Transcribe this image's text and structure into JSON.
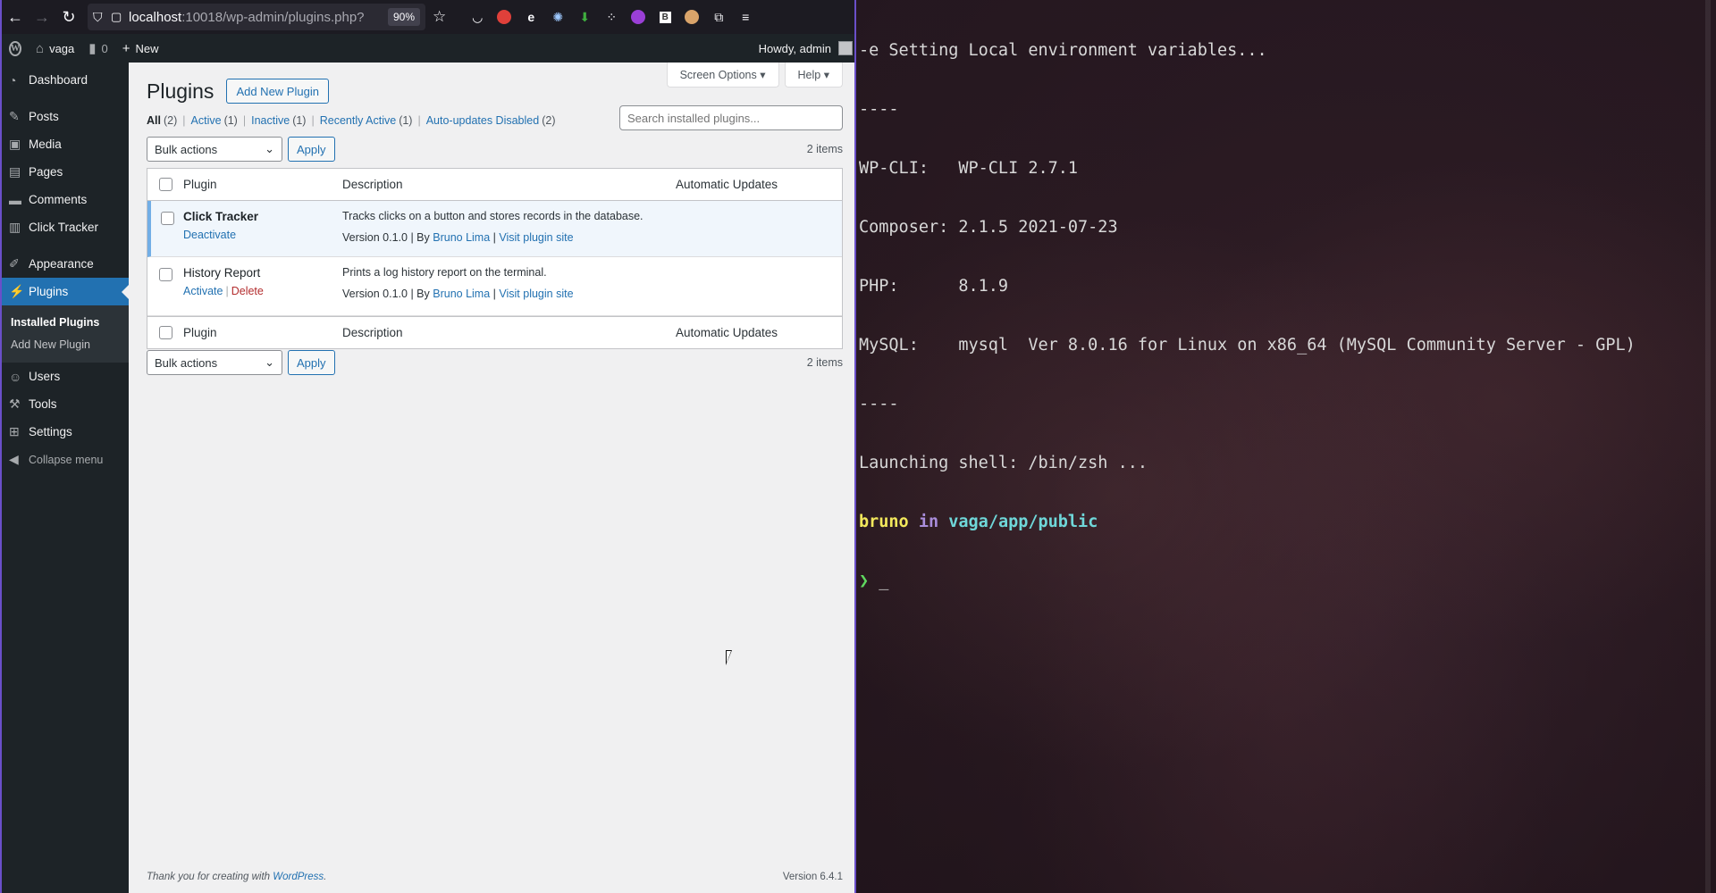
{
  "browser": {
    "url_host": "localhost",
    "url_path": ":10018/wp-admin/plugins.php?",
    "zoom": "90%"
  },
  "adminbar": {
    "site_name": "vaga",
    "comments_count": "0",
    "new_label": "New",
    "howdy": "Howdy, admin"
  },
  "sidebar": {
    "items": [
      {
        "label": "Dashboard",
        "icon": "dashboard-icon"
      },
      {
        "label": "Posts",
        "icon": "pin-icon"
      },
      {
        "label": "Media",
        "icon": "media-icon"
      },
      {
        "label": "Pages",
        "icon": "pages-icon"
      },
      {
        "label": "Comments",
        "icon": "comment-icon"
      },
      {
        "label": "Click Tracker",
        "icon": "chart-icon"
      },
      {
        "label": "Appearance",
        "icon": "brush-icon"
      },
      {
        "label": "Plugins",
        "icon": "plugin-icon"
      },
      {
        "label": "Users",
        "icon": "user-icon"
      },
      {
        "label": "Tools",
        "icon": "wrench-icon"
      },
      {
        "label": "Settings",
        "icon": "settings-icon"
      }
    ],
    "submenu": {
      "installed": "Installed Plugins",
      "add_new": "Add New Plugin"
    },
    "collapse": "Collapse menu"
  },
  "content": {
    "screen_options": "Screen Options",
    "help": "Help",
    "title": "Plugins",
    "add_new_button": "Add New Plugin",
    "filters": {
      "all": "All",
      "all_count": "(2)",
      "active": "Active",
      "active_count": "(1)",
      "inactive": "Inactive",
      "inactive_count": "(1)",
      "recent": "Recently Active",
      "recent_count": "(1)",
      "autoupd": "Auto-updates Disabled",
      "autoupd_count": "(2)"
    },
    "search_placeholder": "Search installed plugins...",
    "bulk_actions": "Bulk actions",
    "apply": "Apply",
    "items_count": "2 items",
    "columns": {
      "plugin": "Plugin",
      "description": "Description",
      "auto_updates": "Automatic Updates"
    },
    "plugins": [
      {
        "name": "Click Tracker",
        "action1": "Deactivate",
        "description": "Tracks clicks on a button and stores records in the database.",
        "version": "Version 0.1.0",
        "by": "By",
        "author": "Bruno Lima",
        "visit": "Visit plugin site"
      },
      {
        "name": "History Report",
        "action1": "Activate",
        "action2": "Delete",
        "description": "Prints a log history report on the terminal.",
        "version": "Version 0.1.0",
        "by": "By",
        "author": "Bruno Lima",
        "visit": "Visit plugin site"
      }
    ],
    "footer_thanks": "Thank you for creating with",
    "footer_link": "WordPress",
    "footer_version": "Version 6.4.1"
  },
  "terminal": {
    "lines": [
      "-e Setting Local environment variables...",
      "----",
      "WP-CLI:   WP-CLI 2.7.1",
      "Composer: 2.1.5 2021-07-23",
      "PHP:      8.1.9",
      "MySQL:    mysql  Ver 8.0.16 for Linux on x86_64 (MySQL Community Server - GPL)",
      "----",
      "Launching shell: /bin/zsh ..."
    ],
    "prompt_user": "bruno",
    "prompt_in": "in",
    "prompt_path": "vaga/app/public",
    "prompt_symbol": "❯",
    "cursor": "_"
  },
  "colors": {
    "wp_blue": "#2271b1",
    "wp_dark": "#1d2327",
    "browser_toolbar": "#1c1b22"
  }
}
